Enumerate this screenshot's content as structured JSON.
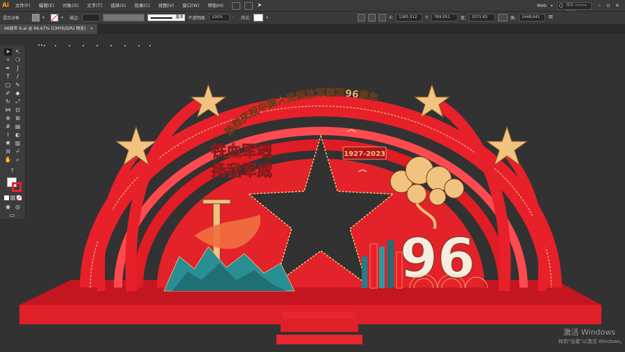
{
  "app": {
    "logo": "Ai",
    "menus": [
      "文件(F)",
      "编辑(E)",
      "对象(O)",
      "文字(T)",
      "选择(S)",
      "效果(C)",
      "视图(V)",
      "窗口(W)",
      "帮助(H)"
    ],
    "workspace": "Web",
    "search_placeholder": "搜索 Adobe Stock"
  },
  "control_bar": {
    "selection_label": "混合对象",
    "stroke_label": "描边:",
    "stroke_profile": "基本",
    "opacity_label": "不透明度:",
    "opacity_value": "100%",
    "style_label": "样式:",
    "x_label": "X:",
    "x_value": "1285.512",
    "y_label": "Y:",
    "y_value": "769.551",
    "w_label": "宽:",
    "w_value": "2571.83",
    "h_label": "高:",
    "h_value": "1448.641"
  },
  "document_tab": {
    "label": "96周年 6.ai @ 66.67% (CMYK/GPU 预览)",
    "close": "×"
  },
  "tools": [
    "selection-tool",
    "direct-selection-tool",
    "magic-wand-tool",
    "lasso-tool",
    "pen-tool",
    "curvature-tool",
    "type-tool",
    "line-tool",
    "rectangle-tool",
    "paintbrush-tool",
    "shaper-tool",
    "pencil-tool",
    "rotate-tool",
    "scale-tool",
    "width-tool",
    "free-transform-tool",
    "shape-builder-tool",
    "perspective-tool",
    "mesh-tool",
    "gradient-tool",
    "eyedropper-tool",
    "blend-tool",
    "symbol-sprayer-tool",
    "graph-tool",
    "artboard-tool",
    "slice-tool",
    "hand-tool",
    "zoom-tool"
  ],
  "artwork": {
    "arch_text": "热烈庆祝中国人民解放军建军96周年",
    "slogan_line1": "铁血军魂",
    "slogan_line2": "扬我军威",
    "dates": "1927-2023",
    "number": "96"
  },
  "colors": {
    "red": "#e8202a",
    "dark_red": "#b3121b",
    "gold": "#f2c27f",
    "teal": "#2a8f94",
    "canvas": "#323232"
  },
  "watermark": {
    "line1": "激活 Windows",
    "line2": "转到\"设置\"以激活 Windows。"
  }
}
